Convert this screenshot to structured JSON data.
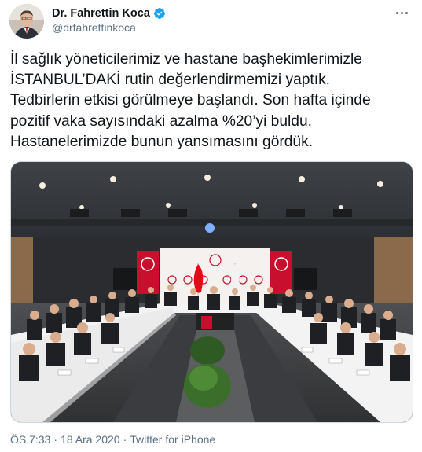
{
  "author": {
    "name": "Dr. Fahrettin Koca",
    "handle": "@drfahrettinkoca",
    "verified": true
  },
  "tweet": {
    "lines": [
      "İl sağlık yöneticilerimiz ve hastane başhekimlerimizle",
      "İSTANBUL’DAKİ rutin değerlendirmemizi yaptık.",
      "Tedbirlerin etkisi görülmeye başlandı. Son hafta içinde",
      "pozitif vaka sayısındaki azalma %20’yi buldu.",
      "Hastanelerimizde bunun yansımasını gördük."
    ]
  },
  "meta": {
    "time": "ÖS 7:33",
    "separator": "·",
    "date": "18 Ara 2020",
    "source": "Twitter for iPhone"
  },
  "icons": {
    "verified": "verified-badge-icon",
    "more": "more-options-icon"
  },
  "colors": {
    "verified_blue": "#1da1f2",
    "secondary_text": "#5b7083",
    "flag_red": "#e30a17"
  }
}
